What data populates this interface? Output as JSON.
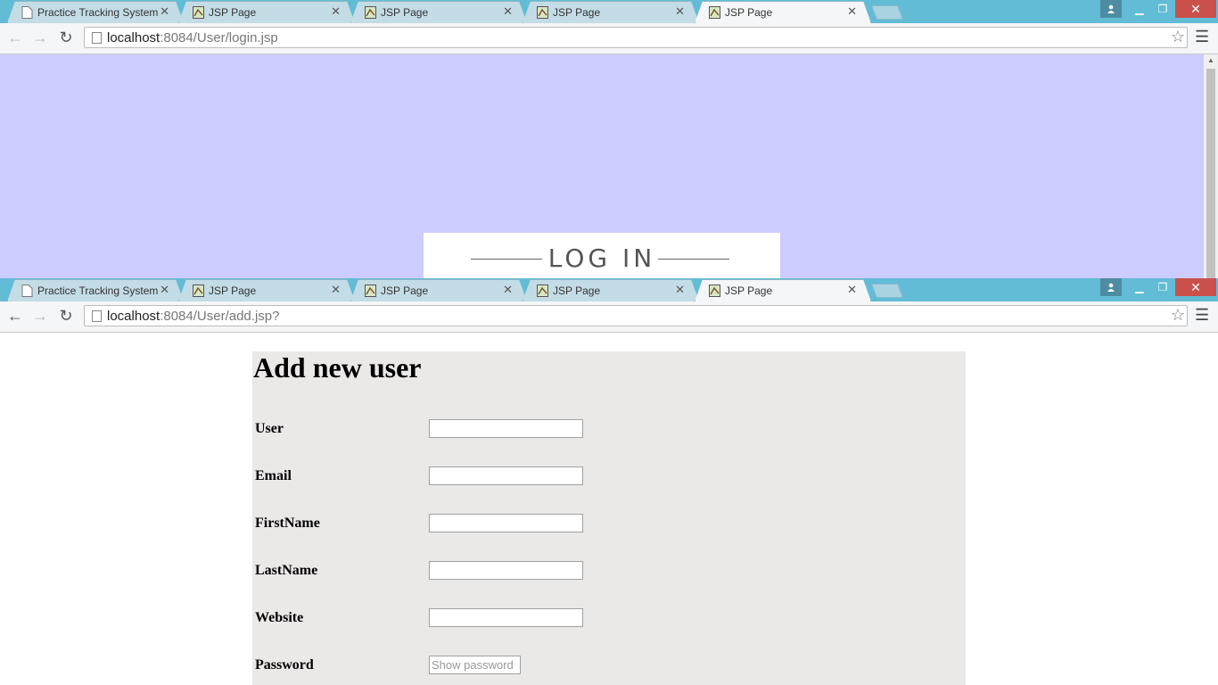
{
  "window1": {
    "tabs": [
      {
        "title": "Practice Tracking System"
      },
      {
        "title": "JSP Page"
      },
      {
        "title": "JSP Page"
      },
      {
        "title": "JSP Page"
      },
      {
        "title": "JSP Page"
      }
    ],
    "url_host": "localhost",
    "url_rest": ":8084/User/login.jsp",
    "login_heading": "LOG IN",
    "background_color": "#ccccff"
  },
  "window2": {
    "tabs": [
      {
        "title": "Practice Tracking System"
      },
      {
        "title": "JSP Page"
      },
      {
        "title": "JSP Page"
      },
      {
        "title": "JSP Page"
      },
      {
        "title": "JSP Page"
      }
    ],
    "url_host": "localhost",
    "url_rest": ":8084/User/add.jsp?",
    "form": {
      "title": "Add new user",
      "fields": [
        {
          "label": "User",
          "value": ""
        },
        {
          "label": "Email",
          "value": ""
        },
        {
          "label": "FirstName",
          "value": ""
        },
        {
          "label": "LastName",
          "value": ""
        },
        {
          "label": "Website",
          "value": ""
        },
        {
          "label": "Password",
          "placeholder": "Show password"
        }
      ]
    }
  },
  "icons": {
    "back": "arrow-left-icon",
    "forward": "arrow-right-icon",
    "reload": "reload-icon",
    "bookmark": "star-icon",
    "menu": "hamburger-menu-icon",
    "close_tab": "close-icon"
  },
  "colors": {
    "tabstrip": "#62bcd6",
    "close_button": "#c9504b",
    "form_panel": "#ebe8e8"
  }
}
